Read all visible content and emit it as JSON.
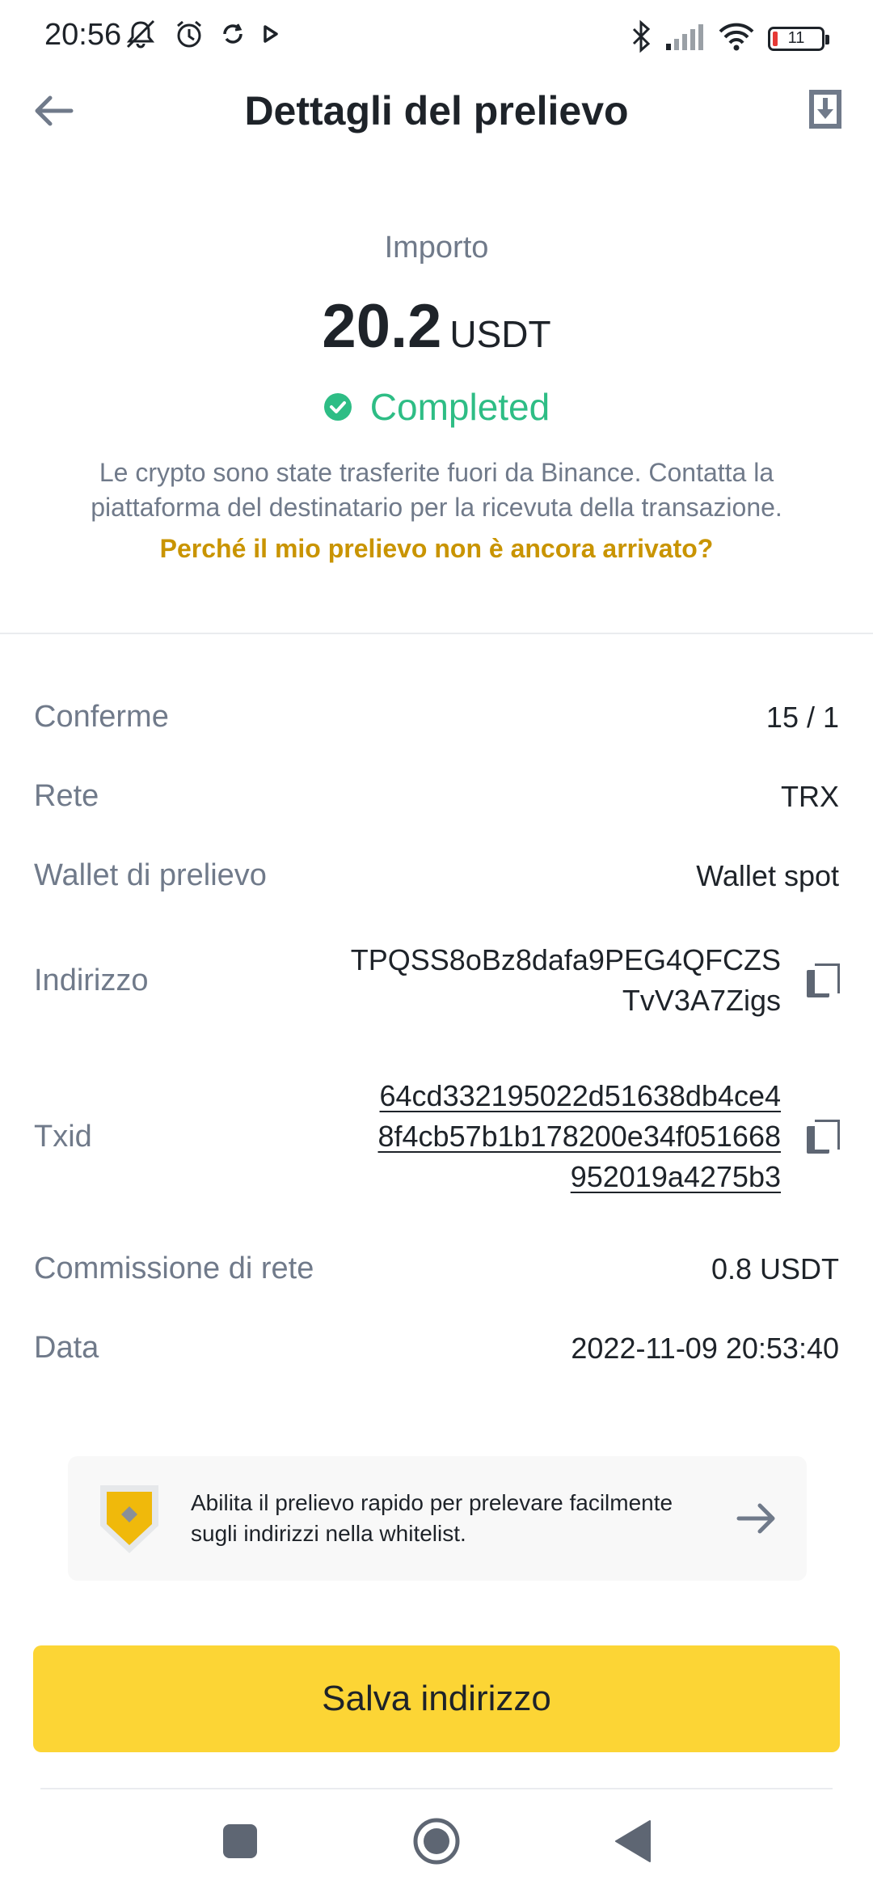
{
  "status_bar": {
    "time": "20:56",
    "battery_level": "11",
    "icons": [
      "mute-icon",
      "alarm-icon",
      "sync-icon",
      "play-icon",
      "bluetooth-icon",
      "signal-icon",
      "wifi-icon",
      "battery-icon"
    ]
  },
  "header": {
    "title": "Dettagli del prelievo"
  },
  "amount": {
    "label": "Importo",
    "value": "20.2",
    "unit": "USDT",
    "status": "Completed",
    "status_color": "#2ebd85",
    "info": "Le crypto sono state trasferite fuori da Binance. Contatta la piattaforma del destinatario per la ricevuta della transazione.",
    "why_link": "Perché il mio prelievo non è ancora arrivato?"
  },
  "details": {
    "confirmations": {
      "label": "Conferme",
      "value": "15 / 1"
    },
    "network": {
      "label": "Rete",
      "value": "TRX"
    },
    "wallet": {
      "label": "Wallet di prelievo",
      "value": "Wallet spot"
    },
    "address": {
      "label": "Indirizzo",
      "line1": "TPQSS8oBz8dafa9PEG4QFCZS",
      "line2": "TvV3A7Zigs"
    },
    "txid": {
      "label": "Txid",
      "line1": "64cd332195022d51638db4ce4",
      "line2": "8f4cb57b1b178200e34f051668",
      "line3": "952019a4275b3"
    },
    "fee": {
      "label": "Commissione di rete",
      "value": "0.8 USDT"
    },
    "date": {
      "label": "Data",
      "value": "2022-11-09 20:53:40"
    }
  },
  "promo": {
    "text": "Abilita il prelievo rapido per prelevare facilmente sugli indirizzi nella whitelist."
  },
  "primary_button": {
    "label": "Salva indirizzo",
    "color": "#fcd535"
  },
  "nav": {
    "items": [
      "recents-button",
      "home-button",
      "back-button"
    ]
  }
}
